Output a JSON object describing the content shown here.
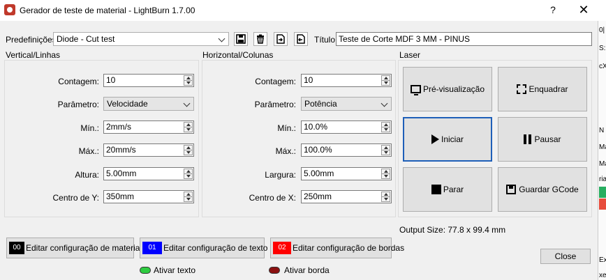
{
  "window": {
    "title": "Gerador de teste de material - LightBurn 1.7.00",
    "help_label": "?",
    "close_label": "✕"
  },
  "presets": {
    "label": "Predefinições",
    "selected": "Diode - Cut test",
    "title_label": "Título",
    "title_value": "Teste de Corte MDF 3 MM - PINUS"
  },
  "vertical": {
    "group_title": "Vertical/Linhas",
    "count_label": "Contagem:",
    "count_value": "10",
    "param_label": "Parâmetro:",
    "param_value": "Velocidade",
    "min_label": "Mín.:",
    "min_value": "2mm/s",
    "max_label": "Máx.:",
    "max_value": "20mm/s",
    "height_label": "Altura:",
    "height_value": "5.00mm",
    "center_label": "Centro de Y:",
    "center_value": "350mm"
  },
  "horizontal": {
    "group_title": "Horizontal/Colunas",
    "count_label": "Contagem:",
    "count_value": "10",
    "param_label": "Parâmetro:",
    "param_value": "Potência",
    "min_label": "Mín.:",
    "min_value": "10.0%",
    "max_label": "Máx.:",
    "max_value": "100.0%",
    "width_label": "Largura:",
    "width_value": "5.00mm",
    "center_label": "Centro de X:",
    "center_value": "250mm"
  },
  "laser": {
    "group_title": "Laser",
    "preview": "Pré-visualização",
    "frame": "Enquadrar",
    "start": "Iniciar",
    "pause": "Pausar",
    "stop": "Parar",
    "save_gcode": "Guardar GCode",
    "output_size": "Output Size: 77.8 x 99.4 mm"
  },
  "config": {
    "material_chip": "00",
    "material_label": "Editar configuração de material",
    "text_chip": "01",
    "text_label": "Editar configuração de texto",
    "border_chip": "02",
    "border_label": "Editar configuração de bordas",
    "enable_text": "Ativar texto",
    "enable_border": "Ativar borda",
    "close": "Close"
  },
  "colors": {
    "chip_material": "#000000",
    "chip_text": "#0000ff",
    "chip_border": "#ff0000",
    "toggle_text": "#2ecc40",
    "toggle_border": "#8b1010",
    "focus_border": "#1e5fb8"
  },
  "side_strip": [
    "0|",
    "S:",
    "cX",
    "N",
    "Ma",
    "Ma",
    "ria",
    "Ex",
    "xe"
  ]
}
